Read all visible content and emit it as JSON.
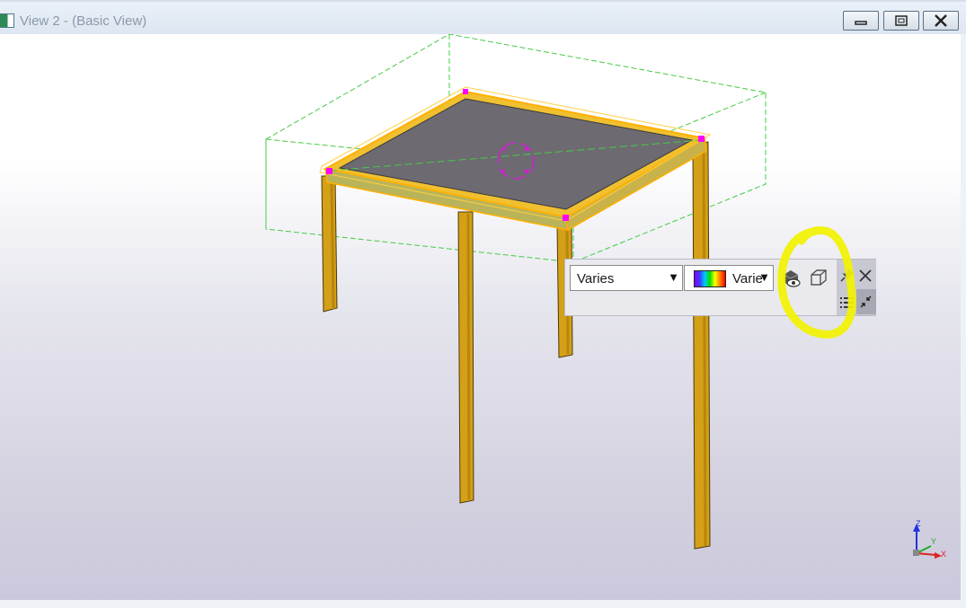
{
  "window": {
    "title": "View 2 - (Basic View)",
    "controls": {
      "minimize": "minimize",
      "restore": "restore",
      "close": "close"
    }
  },
  "toolbar": {
    "class_dropdown": {
      "value": "Varies"
    },
    "color_dropdown": {
      "value": "Varies"
    },
    "icons": [
      "visibility-eye-icon",
      "3d-box-icon",
      "pin-icon",
      "close-icon",
      "list-icon",
      "collapse-arrows-icon"
    ]
  },
  "axes": {
    "z": "Z",
    "y": "Y",
    "x": "X"
  },
  "colors": {
    "beam": "#d4a017",
    "plate": "#6e6a72",
    "selection": "#ffb000",
    "handle": "#ff00ff",
    "bbox": "#44cc44",
    "annotation": "#f2f200"
  }
}
